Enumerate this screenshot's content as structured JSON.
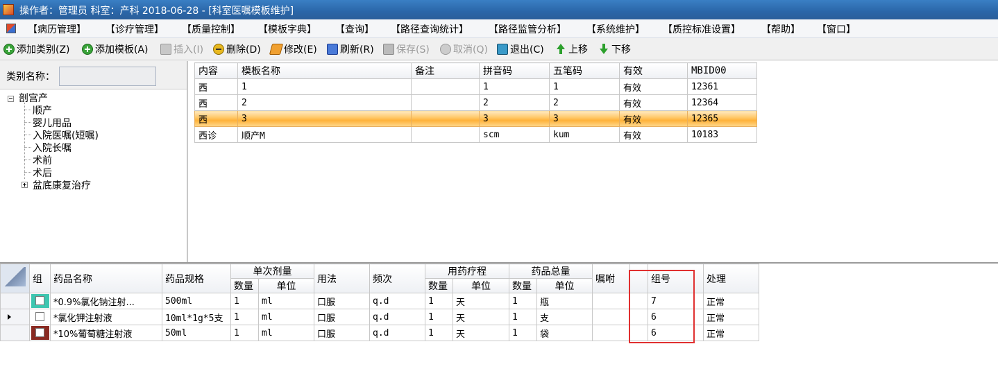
{
  "title_bar": {
    "text": "操作者：管理员  科室：产科  2018-06-28 - [科室医嘱模板维护]"
  },
  "menu": [
    "【病历管理】",
    "【诊疗管理】",
    "【质量控制】",
    "【模板字典】",
    "【查询】",
    "【路径查询统计】",
    "【路径监管分析】",
    "【系统维护】",
    "【质控标准设置】",
    "【帮助】",
    "【窗口】"
  ],
  "toolbar": {
    "add_category": "添加类别(Z)",
    "add_template": "添加模板(A)",
    "insert": "插入(I)",
    "delete": "删除(D)",
    "edit": "修改(E)",
    "refresh": "刷新(R)",
    "save": "保存(S)",
    "cancel": "取消(Q)",
    "exit": "退出(C)",
    "move_up": "上移",
    "move_down": "下移"
  },
  "category": {
    "label": "类别名称：",
    "value": ""
  },
  "tree": {
    "root": "剖宫产",
    "children": [
      "顺产",
      "婴儿用品",
      "入院医嘱(短嘱)",
      "入院长嘱",
      "术前",
      "术后"
    ],
    "collapsed": "盆底康复治疗"
  },
  "template_table": {
    "headers": [
      "内容",
      "模板名称",
      "备注",
      "拼音码",
      "五笔码",
      "有效",
      "MBID00"
    ],
    "rows": [
      [
        "西",
        "1",
        "",
        "1",
        "1",
        "有效",
        "12361"
      ],
      [
        "西",
        "2",
        "",
        "2",
        "2",
        "有效",
        "12364"
      ],
      [
        "西",
        "3",
        "",
        "3",
        "3",
        "有效",
        "12365"
      ],
      [
        "西诊",
        "顺产M",
        "",
        "scm",
        "kum",
        "有效",
        "10183"
      ]
    ],
    "selected_row": 2
  },
  "drug_table": {
    "headers": {
      "group": "组",
      "name": "药品名称",
      "spec": "药品规格",
      "dose": "单次剂量",
      "usage": "用法",
      "freq": "频次",
      "course": "用药疗程",
      "total": "药品总量",
      "note": "嘱咐",
      "group_no": "组号",
      "handle": "处理",
      "qty": "数量",
      "unit": "单位"
    },
    "rows": [
      {
        "name": "*0.9%氯化钠注射...",
        "spec": "500ml",
        "dose_qty": "1",
        "dose_unit": "ml",
        "usage": "口服",
        "freq": "q.d",
        "course_qty": "1",
        "course_unit": "天",
        "total_qty": "1",
        "total_unit": "瓶",
        "note": "",
        "group_no": "7",
        "handle": "正常",
        "group_color": "teal"
      },
      {
        "name": "*氯化钾注射液",
        "spec": "10ml*1g*5支",
        "dose_qty": "1",
        "dose_unit": "ml",
        "usage": "口服",
        "freq": "q.d",
        "course_qty": "1",
        "course_unit": "天",
        "total_qty": "1",
        "total_unit": "支",
        "note": "",
        "group_no": "6",
        "handle": "正常",
        "group_color": "none"
      },
      {
        "name": "*10%葡萄糖注射液",
        "spec": "50ml",
        "dose_qty": "1",
        "dose_unit": "ml",
        "usage": "口服",
        "freq": "q.d",
        "course_qty": "1",
        "course_unit": "天",
        "total_qty": "1",
        "total_unit": "袋",
        "note": "",
        "group_no": "6",
        "handle": "正常",
        "group_color": "maroon"
      }
    ],
    "current_row": 1
  },
  "colors": {
    "highlight": "#e03030",
    "selection": "#ffc96a",
    "title_bar": "#2a66a8"
  }
}
